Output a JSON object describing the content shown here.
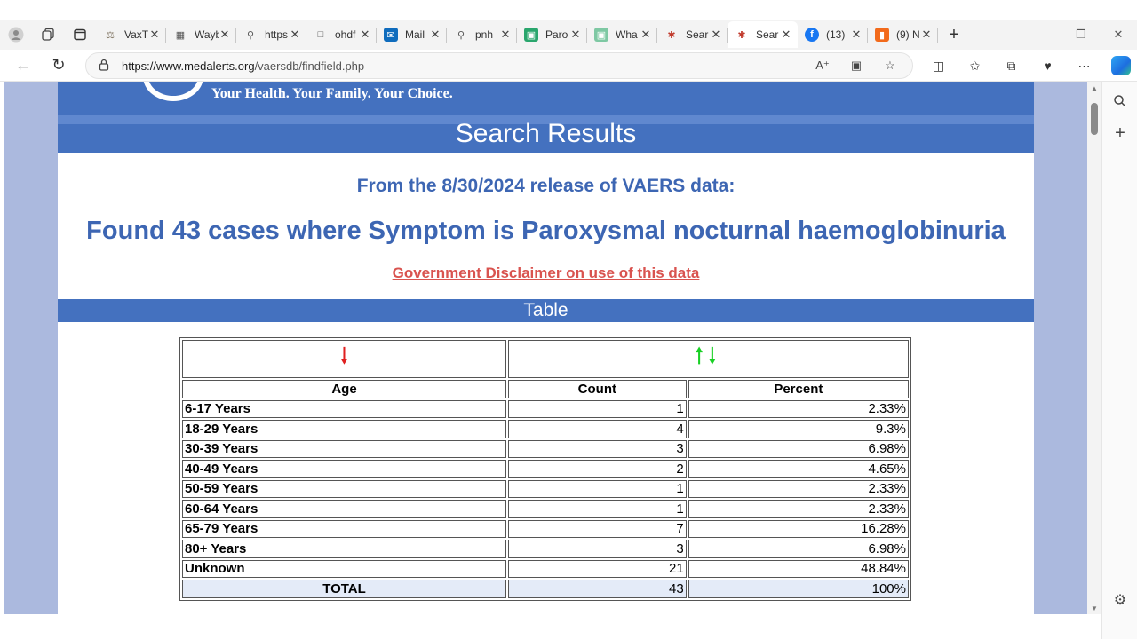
{
  "browser": {
    "tabs": [
      {
        "title": "VaxTr",
        "favicon": "scale-icon",
        "color": "#8a7f6e",
        "active": false
      },
      {
        "title": "Wayb",
        "favicon": "archive-icon",
        "color": "#555555",
        "active": false
      },
      {
        "title": "https:",
        "favicon": "search-icon",
        "color": "#555555",
        "active": false
      },
      {
        "title": "ohdf",
        "favicon": "document-icon",
        "color": "#555555",
        "active": false
      },
      {
        "title": "Mail",
        "favicon": "mail-icon",
        "color": "#0f6cbd",
        "active": false
      },
      {
        "title": "pnh",
        "favicon": "search-icon",
        "color": "#555555",
        "active": false
      },
      {
        "title": "Paro",
        "favicon": "image-icon",
        "color": "#2aa66d",
        "active": false
      },
      {
        "title": "Wha",
        "favicon": "image-icon",
        "color": "#7ec8a3",
        "active": false
      },
      {
        "title": "Sear",
        "favicon": "star-icon",
        "color": "#c0392b",
        "active": false
      },
      {
        "title": "Sear",
        "favicon": "star-icon",
        "color": "#c0392b",
        "active": true
      },
      {
        "title": "(13)",
        "favicon": "facebook-icon",
        "color": "#1877f2",
        "active": false
      },
      {
        "title": "(9) N",
        "favicon": "bookmark-icon",
        "color": "#f26a1b",
        "active": false
      }
    ],
    "url_host": "https://www.medalerts.org",
    "url_path": "/vaersdb/findfield.php"
  },
  "site": {
    "tagline": "Your Health. Your Family. Your Choice.",
    "results_heading": "Search Results",
    "release_line": "From the 8/30/2024 release of VAERS data:",
    "found_line": "Found 43 cases where Symptom is Paroxysmal nocturnal haemoglobinuria",
    "disclaimer": "Government Disclaimer on use of this data",
    "table_heading": "Table"
  },
  "table": {
    "headers": [
      "Age",
      "Count",
      "Percent"
    ],
    "rows": [
      {
        "age": "6-17 Years",
        "count": "1",
        "percent": "2.33%"
      },
      {
        "age": "18-29 Years",
        "count": "4",
        "percent": "9.3%"
      },
      {
        "age": "30-39 Years",
        "count": "3",
        "percent": "6.98%"
      },
      {
        "age": "40-49 Years",
        "count": "2",
        "percent": "4.65%"
      },
      {
        "age": "50-59 Years",
        "count": "1",
        "percent": "2.33%"
      },
      {
        "age": "60-64 Years",
        "count": "1",
        "percent": "2.33%"
      },
      {
        "age": "65-79 Years",
        "count": "7",
        "percent": "16.28%"
      },
      {
        "age": "80+ Years",
        "count": "3",
        "percent": "6.98%"
      },
      {
        "age": "Unknown",
        "count": "21",
        "percent": "48.84%"
      }
    ],
    "total": {
      "age": "TOTAL",
      "count": "43",
      "percent": "100%"
    }
  }
}
